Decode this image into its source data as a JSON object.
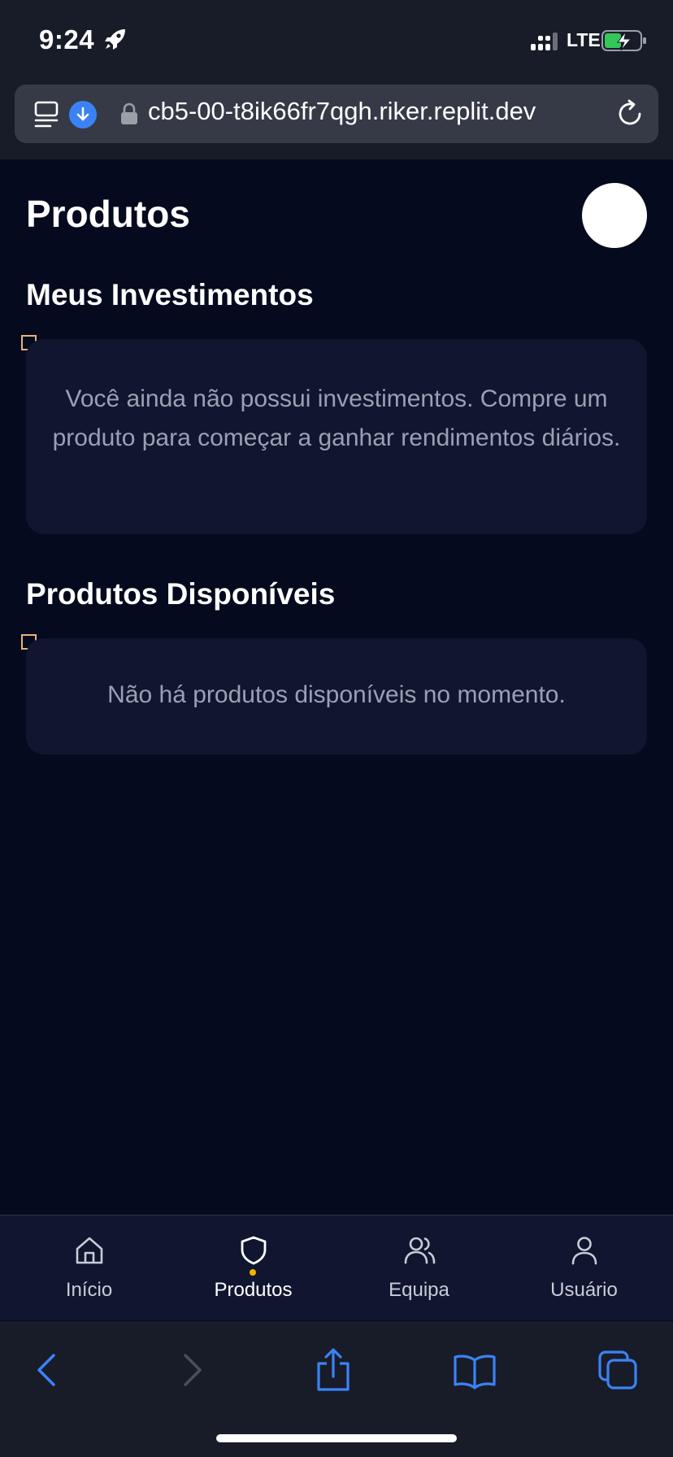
{
  "status_bar": {
    "time": "9:24",
    "network": "LTE",
    "icons": [
      "rocket-icon",
      "signal-icon",
      "battery-charging-icon"
    ]
  },
  "browser": {
    "url": "cb5-00-t8ik66fr7qgh.riker.replit.dev",
    "icons": [
      "reader-icon",
      "download-icon",
      "lock-icon",
      "reload-icon"
    ]
  },
  "page": {
    "title": "Produtos",
    "sections": [
      {
        "title": "Meus Investimentos",
        "empty_message": "Você ainda não possui investimentos. Compre um produto para começar a ganhar rendimentos diários."
      },
      {
        "title": "Produtos Disponíveis",
        "empty_message": "Não há produtos disponíveis no momento."
      }
    ]
  },
  "tab_bar": {
    "active": "Produtos",
    "active_dot_color": "#f5b400",
    "tabs": [
      {
        "label": "Início",
        "icon": "home-icon"
      },
      {
        "label": "Produtos",
        "icon": "shield-icon"
      },
      {
        "label": "Equipa",
        "icon": "users-icon"
      },
      {
        "label": "Usuário",
        "icon": "user-icon"
      }
    ]
  },
  "safari_toolbar": {
    "icons": [
      "back-icon",
      "forward-icon",
      "share-icon",
      "bookmarks-icon",
      "tabs-icon"
    ],
    "accent_color": "#3b82f6"
  }
}
